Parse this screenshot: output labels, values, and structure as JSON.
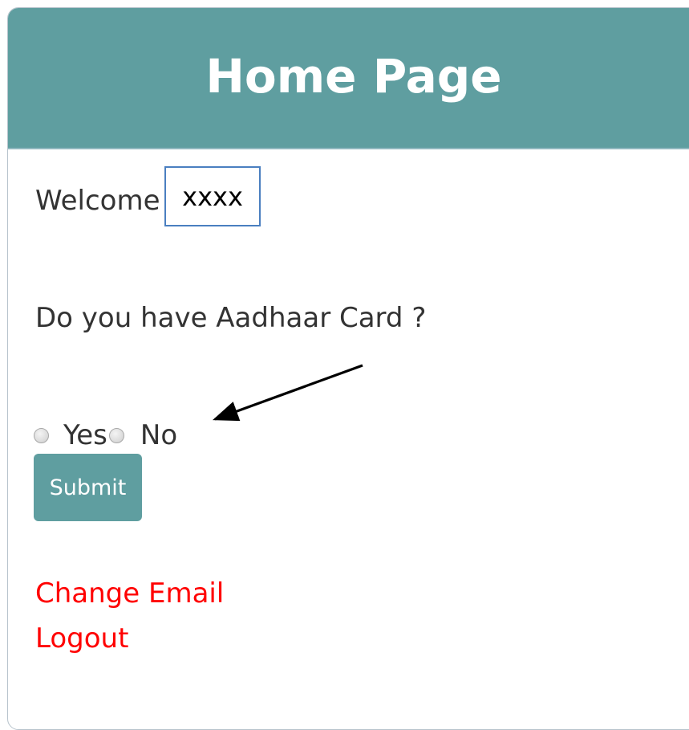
{
  "header": {
    "title": "Home Page"
  },
  "welcome": {
    "label": "Welcome",
    "username": "xxxx"
  },
  "question": {
    "text": "Do you have Aadhaar Card ?"
  },
  "radio_options": [
    {
      "label": "Yes",
      "checked": false
    },
    {
      "label": "No",
      "checked": false
    }
  ],
  "actions": {
    "submit_label": "Submit"
  },
  "links": {
    "change_email": "Change Email",
    "logout": "Logout"
  },
  "colors": {
    "header_bg": "#5f9ea0",
    "button_bg": "#5f9ea0",
    "link_color": "#ff0000",
    "text_color": "#333333",
    "highlight_box_border": "#4a7fc0"
  },
  "annotation": {
    "type": "arrow-pointing-to-no-option"
  }
}
